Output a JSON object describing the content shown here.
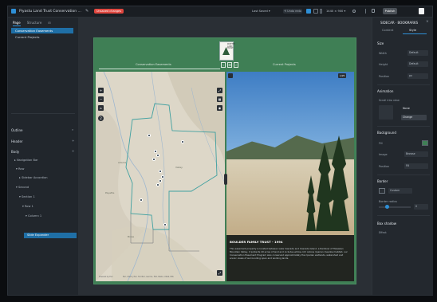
{
  "topbar": {
    "title": "Piyastu Land Trust Conservation ...",
    "edit_icon": "✎",
    "status_pill": "Unsaved changes",
    "save_status": "Last Saved ▾",
    "history_label": "⟲ Undo redo",
    "zoom": "1440 × 900 ▾",
    "publish_label": "Publish"
  },
  "left_panel": {
    "tabs": [
      "Page",
      "Structure"
    ],
    "pages": [
      "Conservation Easements",
      "Current Projects"
    ],
    "sections": [
      {
        "label": "Outline",
        "action": "⌕"
      },
      {
        "label": "Header",
        "action": "+"
      },
      {
        "label": "Body",
        "action": "+"
      }
    ],
    "tree": [
      "Navigation Bar",
      "Row",
      "Sidebar Accordion",
      "Second",
      "Section 1",
      "Row 1",
      "Column 1"
    ],
    "tree_selected": "Slide Expander"
  },
  "canvas": {
    "logo_text": "PAYETTE LAND TRUST",
    "nav_tabs": [
      "Conservation Easements",
      "Current Projects"
    ],
    "nav_buttons": [
      "‹",
      "☰",
      "›"
    ],
    "map_buttons": [
      "+",
      "−",
      "⌂",
      "⤢",
      "▦",
      "◉"
    ],
    "map_count_badge": "2",
    "photo_badge": "1/25",
    "caption_title": "BOULDER FAMILY TRUST - 1994",
    "caption_body": "This easement property is located between Lake Cascade and Cascade Island, a Rainbow of Hawaiian Mountain Valley, it protects 40 acres of land and includes willow-rich oxbow riparian meadow habitat, our Conservation Easement Program also conserved approximately the riparian wetlands, watershed and scenic views of surrounding open and working lands.",
    "map_attribution": "Esri, USGS | Esri, TomTom, Garmin, FAO, NOAA, USGS, EPA",
    "map_powered": "Powered by Esri",
    "map_labels": [
      "Adams",
      "Valley",
      "Boise",
      "Payette"
    ]
  },
  "right_panel": {
    "title": "SIDECAR  ·  BOOKMARKS",
    "tabs": [
      "Content",
      "Style"
    ],
    "sections": [
      "Size",
      "Animation",
      "Background",
      "Border",
      "Box shadow"
    ],
    "size_fields": [
      {
        "label": "Width",
        "value": "Default"
      },
      {
        "label": "Height",
        "value": "Default"
      },
      {
        "label": "Position",
        "value": "px"
      }
    ],
    "animation_label": "Scroll into view",
    "animation_value": "None",
    "animation_button": "Change",
    "bg_fields": [
      {
        "label": "Fill",
        "value": ""
      },
      {
        "label": "Image",
        "value": "Browse"
      },
      {
        "label": "Position",
        "value": "Fill"
      }
    ],
    "border_value": "Custom",
    "border_radius_label": "Border radius",
    "shadow_label": "Effect"
  },
  "colors": {
    "accent": "#2e8fd6",
    "canvas_green": "#3f7f55",
    "unsaved": "#e0473f"
  }
}
